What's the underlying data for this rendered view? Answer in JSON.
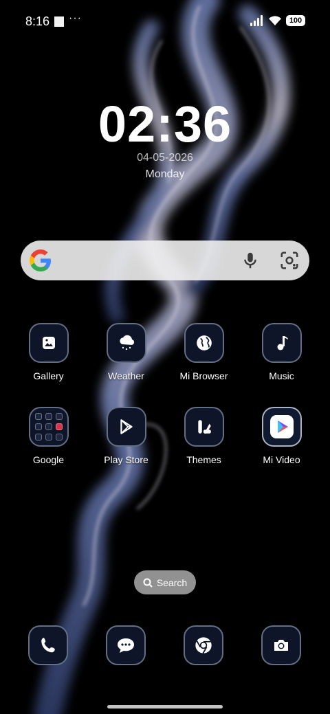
{
  "status_bar": {
    "time": "8:16",
    "more": "···",
    "battery": "100"
  },
  "clock": {
    "time": "02:36",
    "date": "04-05-2026",
    "weekday": "Monday"
  },
  "search_widget": {
    "logo": "google-g-icon",
    "mic": "mic-icon",
    "lens": "lens-icon"
  },
  "apps": [
    {
      "label": "Gallery",
      "icon": "gallery-icon"
    },
    {
      "label": "Weather",
      "icon": "weather-icon"
    },
    {
      "label": "Mi Browser",
      "icon": "globe-icon"
    },
    {
      "label": "Music",
      "icon": "music-icon"
    },
    {
      "label": "Google",
      "icon": "folder-icon"
    },
    {
      "label": "Play Store",
      "icon": "play-store-icon"
    },
    {
      "label": "Themes",
      "icon": "themes-icon"
    },
    {
      "label": "Mi Video",
      "icon": "mi-video-icon"
    }
  ],
  "app_search": {
    "label": "Search"
  },
  "dock": [
    {
      "icon": "phone-icon"
    },
    {
      "icon": "messages-icon"
    },
    {
      "icon": "chrome-icon"
    },
    {
      "icon": "camera-icon"
    }
  ],
  "colors": {
    "icon_bg": "#0e1528",
    "icon_border": "#aab9d2",
    "google_blue": "#4285F4",
    "google_red": "#EA4335",
    "google_yellow": "#FBBC05",
    "google_green": "#34A853"
  }
}
